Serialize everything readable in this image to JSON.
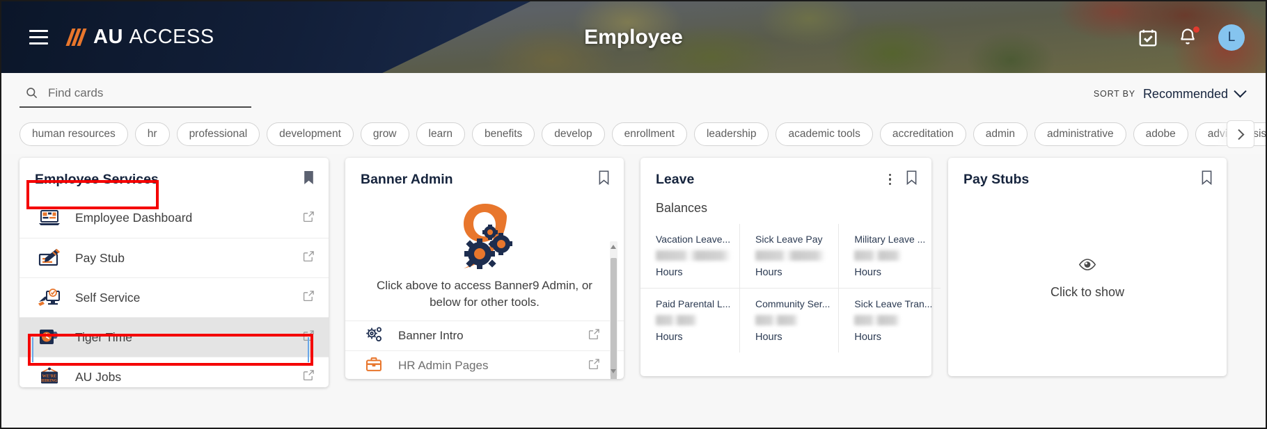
{
  "header": {
    "brand_bold": "AU",
    "brand_light": "ACCESS",
    "page_title": "Employee",
    "menu_icon": "hamburger-icon",
    "calendar_icon": "calendar-check-icon",
    "bell_icon": "notification-bell-icon",
    "avatar_initial": "L"
  },
  "toolbar": {
    "search_placeholder": "Find cards",
    "search_value": "",
    "search_icon": "search-icon",
    "sort_by_label": "SORT BY",
    "sort_by_value": "Recommended"
  },
  "tags": [
    "human resources",
    "hr",
    "professional",
    "development",
    "grow",
    "learn",
    "benefits",
    "develop",
    "enrollment",
    "leadership",
    "academic tools",
    "accreditation",
    "admin",
    "administrative",
    "adobe",
    "advise assist"
  ],
  "tag_next_label": "›",
  "cards": {
    "employee_services": {
      "title": "Employee Services",
      "bookmark_icon": "bookmark-filled-icon",
      "items": [
        {
          "label": "Employee Dashboard",
          "icon": "laptop-dashboard-icon",
          "external_icon": "external-link-icon",
          "active": false
        },
        {
          "label": "Pay Stub",
          "icon": "check-pen-icon",
          "external_icon": "external-link-icon",
          "active": false
        },
        {
          "label": "Self Service",
          "icon": "monitor-hand-icon",
          "external_icon": "external-link-icon",
          "active": false
        },
        {
          "label": "Tiger Time",
          "icon": "time-clock-icon",
          "external_icon": "external-link-icon",
          "active": true
        },
        {
          "label": "AU Jobs",
          "icon": "were-hiring-sign-icon",
          "external_icon": "external-link-icon",
          "active": false
        }
      ]
    },
    "banner_admin": {
      "title": "Banner Admin",
      "bookmark_icon": "bookmark-outline-icon",
      "logo_icon": "banner9-gears-logo",
      "caption": "Click above to access Banner9 Admin, or below for other tools.",
      "items": [
        {
          "label": "Banner Intro",
          "icon": "gears-icon",
          "external_icon": "external-link-icon"
        },
        {
          "label": "HR Admin Pages",
          "icon": "briefcase-icon",
          "external_icon": "external-link-icon"
        }
      ],
      "scrollbar": "vertical-scrollbar"
    },
    "leave": {
      "title": "Leave",
      "kebab_icon": "more-options-icon",
      "bookmark_icon": "bookmark-outline-icon",
      "subtitle": "Balances",
      "balances": [
        {
          "name": "Vacation Leave...",
          "value": "",
          "unit": "Hours"
        },
        {
          "name": "Sick Leave Pay",
          "value": "",
          "unit": "Hours"
        },
        {
          "name": "Military Leave ...",
          "value": "",
          "unit": "Hours"
        },
        {
          "name": "Paid Parental L...",
          "value": "",
          "unit": "Hours"
        },
        {
          "name": "Community Ser...",
          "value": "",
          "unit": "Hours"
        },
        {
          "name": "Sick Leave Tran...",
          "value": "",
          "unit": "Hours"
        }
      ]
    },
    "pay_stubs": {
      "title": "Pay Stubs",
      "bookmark_icon": "bookmark-outline-icon",
      "eye_icon": "eye-icon",
      "reveal_label": "Click to show"
    }
  },
  "colors": {
    "brand_navy": "#16243d",
    "brand_orange": "#e8762c",
    "annotation_red": "#f40000",
    "avatar_blue": "#85c4ef",
    "active_row": "#e4e4e4"
  }
}
